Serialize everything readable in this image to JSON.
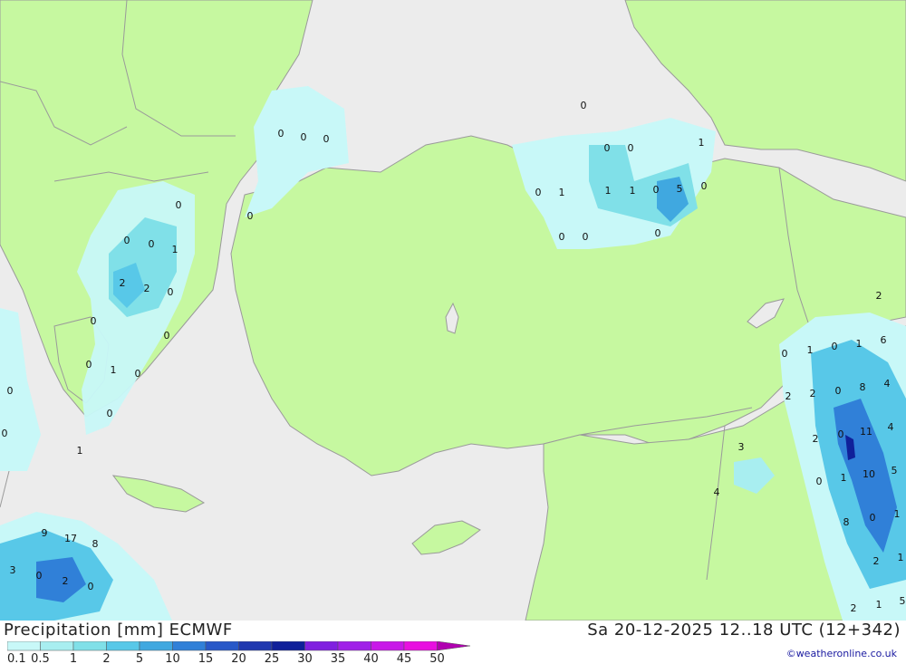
{
  "footer": {
    "title": "Precipitation [mm] ECMWF",
    "datetime": "Sa 20-12-2025 12..18 UTC (12+342)",
    "credit": "©weatheronline.co.uk"
  },
  "legend": {
    "labels": [
      "0.1",
      "0.5",
      "1",
      "2",
      "5",
      "10",
      "15",
      "20",
      "25",
      "30",
      "35",
      "40",
      "45",
      "50"
    ],
    "colors": [
      "#c8f8f8",
      "#a8eef0",
      "#80e0e8",
      "#58c8e8",
      "#40a8e0",
      "#3080d8",
      "#2858c8",
      "#2038b0",
      "#10209a",
      "#8020e0",
      "#a020e8",
      "#c818e8",
      "#e810e0",
      "#b000b0"
    ]
  },
  "map_colors": {
    "sea": "#ececec",
    "land": "#c6f8a0",
    "border": "#9a9a9a"
  },
  "values": [
    "0",
    "0",
    "0",
    "0",
    "0",
    "0",
    "0",
    "1",
    "0",
    "1",
    "1",
    "1",
    "0",
    "5",
    "0",
    "0",
    "0",
    "0",
    "0",
    "0",
    "0",
    "1",
    "2",
    "2",
    "0",
    "0",
    "0",
    "0",
    "1",
    "0",
    "0",
    "0",
    "0",
    "1",
    "2",
    "0",
    "1",
    "0",
    "1",
    "6",
    "2",
    "2",
    "0",
    "8",
    "4",
    "2",
    "0",
    "11",
    "4",
    "3",
    "0",
    "1",
    "10",
    "5",
    "4",
    "8",
    "0",
    "1",
    "2",
    "1",
    "2",
    "1",
    "5",
    "9",
    "17",
    "8",
    "3",
    "0",
    "2",
    "0"
  ]
}
